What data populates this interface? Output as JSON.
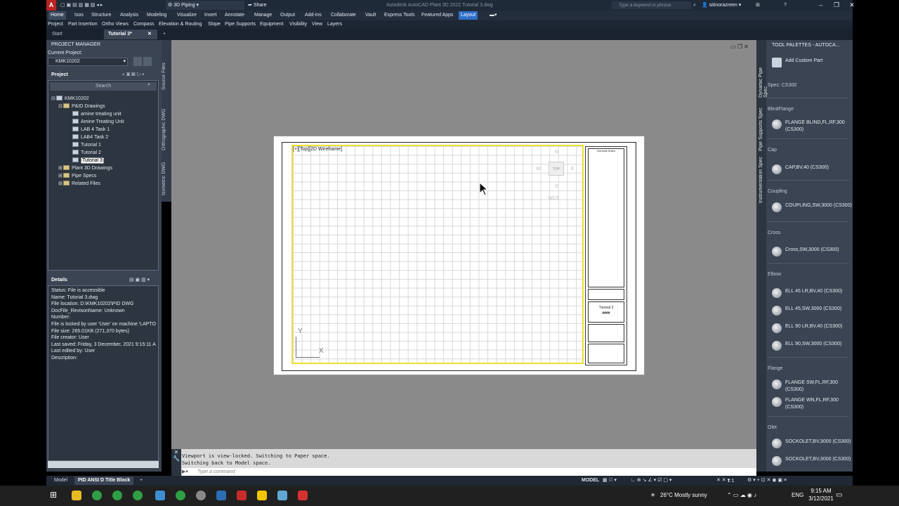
{
  "titlebar": {
    "workspace": "3D Piping",
    "share": "Share",
    "title": "Autodesk AutoCAD Plant 3D 2022   Tutorial 3.dwg",
    "search_placeholder": "Type a keyword or phrase",
    "user": "sitinorazreen"
  },
  "ribbon_tabs": [
    "Home",
    "Isos",
    "Structure",
    "Analysis",
    "Modeling",
    "Visualize",
    "Insert",
    "Annotate",
    "Manage",
    "Output",
    "Add-ins",
    "Collaborate",
    "Vault",
    "Express Tools",
    "Featured Apps",
    "Layout"
  ],
  "panels": [
    "Project",
    "Part Insertion",
    "Ortho Views",
    "Compass",
    "Elevation & Routing",
    "Slope",
    "Pipe Supports",
    "Equipment",
    "Visibility",
    "View",
    "Layers"
  ],
  "doc_tabs": [
    "Start",
    "Tutorial 3*"
  ],
  "project_manager": {
    "header": "PROJECT MANAGER",
    "current_project_label": "Current Project:",
    "current_project": "KMK10202",
    "project_label": "Project",
    "search": "Search",
    "tree": [
      {
        "label": "KMK10202"
      },
      {
        "label": "P&ID Drawings"
      },
      {
        "label": "amine treating unit"
      },
      {
        "label": "Amine Treating Unit"
      },
      {
        "label": "LAB 4 Task 1"
      },
      {
        "label": "LAB4 Task 2"
      },
      {
        "label": "Tutorial 1"
      },
      {
        "label": "Tutorial 2"
      },
      {
        "label": "Tutorial 3"
      },
      {
        "label": "Plant 3D Drawings"
      },
      {
        "label": "Pipe Specs"
      },
      {
        "label": "Related Files"
      }
    ],
    "details_label": "Details",
    "details": [
      "Status: File is accessible",
      "Name: Tutorial 3.dwg",
      "File location: D:\\KMK10202\\PID DWG",
      "DocFile_RevisonName:  Unknown",
      "Number:",
      "File is locked by user 'User' on machine 'LAPTO",
      "File size: 265.01KB (271,370 bytes)",
      "File creator: User",
      "Last saved: Friday, 3 December, 2021 9:15:11 A",
      "Last edited by: User",
      "Description:"
    ]
  },
  "side_tabs": [
    "Source Files",
    "Orthographic DWG",
    "Isometric DWG"
  ],
  "viewport": {
    "label": "[+][Top][2D Wireframe]",
    "cube": {
      "n": "N",
      "s": "S",
      "e": "E",
      "w": "W",
      "top": "TOP",
      "wcs": "WCS"
    },
    "ucs_x": "X",
    "ucs_y": "Y",
    "title_block": {
      "heading": "General Notes",
      "drawing_title": "Tutorial 3",
      "number": "####"
    }
  },
  "command": {
    "history": [
      "Viewport is view-locked. Switching to Paper space.",
      "Switching back to Model space."
    ],
    "placeholder": "Type a command"
  },
  "tool_palettes": {
    "header": "TOOL PALETTES - AUTOCA...",
    "vertical_tabs": [
      "Dynamic Pipe Spec",
      "Pipe Supports Spec",
      "Instrumentation Spec"
    ],
    "add_custom": "Add Custom Part",
    "spec": "Spec: CS300",
    "sections": [
      {
        "name": "BlindFlange",
        "items": [
          "FLANGE BLIND,FL,RF,300 (CS300)"
        ]
      },
      {
        "name": "Cap",
        "items": [
          "CAP,BV,40 (CS300)"
        ]
      },
      {
        "name": "Coupling",
        "items": [
          "COUPLING,SW,3000 (CS300)"
        ]
      },
      {
        "name": "Cross",
        "items": [
          "Cross,SW,3000 (CS300)"
        ]
      },
      {
        "name": "Elbow",
        "items": [
          "ELL 45 LR,BV,40 (CS300)",
          "ELL 45,SW,3000 (CS300)",
          "ELL 90 LR,BV,40 (CS300)",
          "ELL 90,SW,3000 (CS300)"
        ]
      },
      {
        "name": "Flange",
        "items": [
          "FLANGE SW,FL,RF,300 (CS300)",
          "FLANGE WN,FL,RF,300 (CS300)"
        ]
      },
      {
        "name": "Olet",
        "items": [
          "SOCKOLET,BV,3000 (CS300)",
          "SOCKOLET,BV,3000 (CS300)"
        ]
      }
    ]
  },
  "layout_tabs": [
    "Model",
    "PID ANSI D Title Block"
  ],
  "status": {
    "model": "MODEL",
    "scale": "1:1"
  },
  "taskbar": {
    "weather": "26°C  Mostly sunny",
    "lang": "ENG",
    "time": "9:15 AM",
    "date": "3/12/2021"
  }
}
